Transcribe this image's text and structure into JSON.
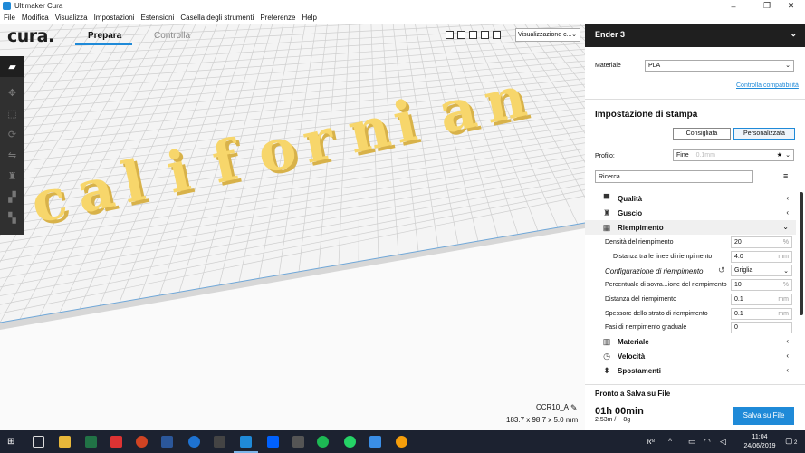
{
  "window": {
    "title": "Ultimaker Cura",
    "controls": [
      "–",
      "❐",
      "✕"
    ]
  },
  "menubar": [
    "File",
    "Modifica",
    "Visualizza",
    "Impostazioni",
    "Estensioni",
    "Casella degli strumenti",
    "Preferenze",
    "Help"
  ],
  "header": {
    "brand": "cura.",
    "tabs": [
      "Prepara",
      "Controlla"
    ],
    "active_tab": "Prepara",
    "view_select": "Visualizzazione c..."
  },
  "model": {
    "text": "californian",
    "name": "CCR10_A",
    "dimensions": "183.7 x 98.7 x 5.0 mm"
  },
  "panel": {
    "printer": "Ender 3",
    "material_label": "Materiale",
    "material_value": "PLA",
    "compat_link": "Controlla compatibilità",
    "settings_title": "Impostazione di stampa",
    "mode_recommended": "Consigliata",
    "mode_custom": "Personalizzata",
    "profile_label": "Profilo:",
    "profile_value": "Fine",
    "profile_hint": "0.1mm",
    "search_placeholder": "Ricerca...",
    "categories_top": [
      {
        "icon": "▀",
        "label": "Qualità",
        "chevron": "‹"
      },
      {
        "icon": "♜",
        "label": "Guscio",
        "chevron": "‹"
      },
      {
        "icon": "▦",
        "label": "Riempimento",
        "chevron": "⌄"
      }
    ],
    "infill_settings": [
      {
        "label": "Densità del riempimento",
        "value": "20",
        "unit": "%"
      },
      {
        "label": "Distanza tra le linee di riempimento",
        "value": "4.0",
        "unit": "mm"
      },
      {
        "label": "Configurazione di riempimento",
        "value": "Griglia",
        "unit": ""
      },
      {
        "label": "Percentuale di sovra...ione del riempimento",
        "value": "10",
        "unit": "%"
      },
      {
        "label": "Distanza del riempimento",
        "value": "0.1",
        "unit": "mm"
      },
      {
        "label": "Spessore dello strato di riempimento",
        "value": "0.1",
        "unit": "mm"
      },
      {
        "label": "Fasi di riempimento graduale",
        "value": "0",
        "unit": ""
      }
    ],
    "categories_bottom": [
      {
        "icon": "▥",
        "label": "Materiale",
        "chevron": "‹"
      },
      {
        "icon": "◷",
        "label": "Velocità",
        "chevron": "‹"
      },
      {
        "icon": "⬍",
        "label": "Spostamenti",
        "chevron": "‹"
      }
    ],
    "footer": {
      "status": "Pronto a Salva su File",
      "time": "01h 00min",
      "material_use": "2.53m / ~ 8g",
      "save_button": "Salva su File"
    }
  },
  "taskbar": {
    "time": "11:04",
    "date": "24/06/2019",
    "notifications": "2"
  },
  "colors": {
    "accent": "#1f8ad8",
    "model_yellow": "#f7d66b",
    "dark_panel": "#1f1f1f",
    "taskbar": "#1c2230"
  }
}
